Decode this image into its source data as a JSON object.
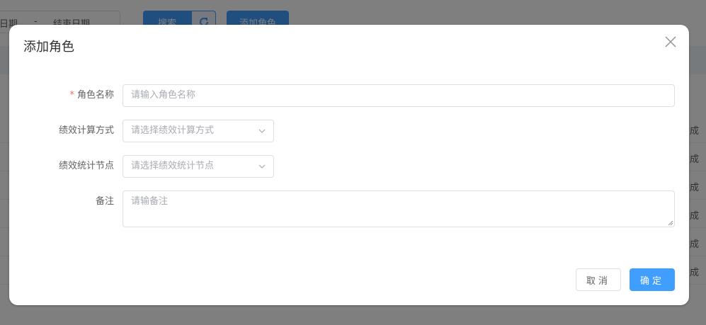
{
  "background": {
    "date_start": "日期",
    "date_sep": "-",
    "date_end": "结束日期",
    "search_label": "搜索",
    "add_role_label": "添加角色",
    "row_status": [
      "成",
      "成",
      "成",
      "成",
      "成",
      "成"
    ]
  },
  "dialog": {
    "title": "添加角色",
    "fields": {
      "role_name": {
        "label": "角色名称",
        "required_mark": "*",
        "placeholder": "请输入角色名称"
      },
      "calc_method": {
        "label": "绩效计算方式",
        "placeholder": "请选择绩效计算方式"
      },
      "stat_node": {
        "label": "绩效统计节点",
        "placeholder": "请选择绩效统计节点"
      },
      "remark": {
        "label": "备注",
        "placeholder": "请输备注"
      }
    },
    "buttons": {
      "cancel": "取消",
      "confirm": "确定"
    }
  },
  "colors": {
    "primary": "#409eff",
    "required": "#f56c6c",
    "overlay": "rgba(0,0,0,0.5)"
  },
  "icons": {
    "close": "close-icon",
    "select_arrow": "chevron-down-icon",
    "refresh": "refresh-icon"
  }
}
